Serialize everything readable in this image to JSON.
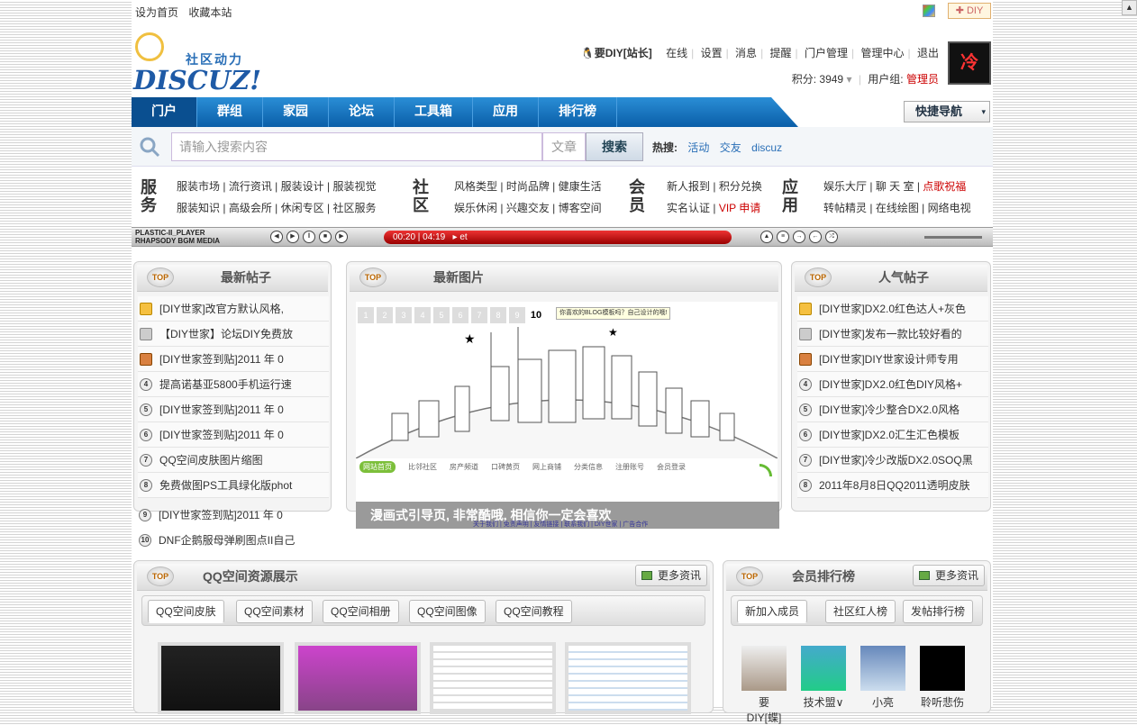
{
  "topbar": {
    "home": "设为首页",
    "fav": "收藏本站",
    "diy": "DIY"
  },
  "user": {
    "name": "要DIY[站长]",
    "links": [
      "在线",
      "设置",
      "消息",
      "提醒",
      "门户管理",
      "管理中心",
      "退出"
    ],
    "points": "积分: 3949",
    "group_label": "用户组:",
    "group": "管理员",
    "avatar_text": "冷"
  },
  "logo": {
    "cn": "社区动力",
    "en": "DISCUZ!"
  },
  "nav": {
    "items": [
      "门户",
      "群组",
      "家园",
      "论坛",
      "工具箱",
      "应用",
      "排行榜"
    ],
    "quick": "快捷导航"
  },
  "search": {
    "placeholder": "请输入搜索内容",
    "category": "文章",
    "button": "搜索",
    "hot_label": "热搜:",
    "hot": [
      "活动",
      "交友",
      "discuz"
    ]
  },
  "services": [
    {
      "head": "服务",
      "rows": [
        [
          "服装市场",
          "流行资讯",
          "服装设计",
          "服装视觉"
        ],
        [
          "服装知识",
          "高级会所",
          "休闲专区",
          "社区服务"
        ]
      ]
    },
    {
      "head": "社区",
      "rows": [
        [
          "风格类型",
          "时尚品牌",
          "健康生活"
        ],
        [
          "娱乐休闲",
          "兴趣交友",
          "博客空间"
        ]
      ]
    },
    {
      "head": "会员",
      "rows": [
        [
          "新人报到",
          "积分兑换"
        ],
        [
          "实名认证",
          "VIP 申请"
        ]
      ]
    },
    {
      "head": "应用",
      "rows": [
        [
          "娱乐大厅",
          "聊 天 室",
          "点歌祝福"
        ],
        [
          "转帖精灵",
          "在线绘图",
          "网络电视"
        ]
      ]
    }
  ],
  "player": {
    "name": "PLASTIC-II_PLAYER",
    "sub": "RHAPSODY BGM MEDIA",
    "time": "00:20 | 04:19",
    "track": "▸ et"
  },
  "latest": {
    "title": "最新帖子",
    "top": "TOP",
    "items": [
      "[DIY世家]改官方默认风格,",
      "【DIY世家】论坛DIY免费放",
      "[DIY世家签到贴]2011 年 0",
      "提高诺基亚5800手机运行速",
      "[DIY世家签到贴]2011 年 0",
      "[DIY世家签到贴]2011 年 0",
      "QQ空间皮肤图片缩图",
      "免费做图PS工具绿化版phot",
      "[DIY世家签到贴]2011 年 0",
      "DNF企鹅服母弹刷图点II自己"
    ]
  },
  "pics": {
    "title": "最新图片",
    "nums": [
      "1",
      "2",
      "3",
      "4",
      "5",
      "6",
      "7",
      "8",
      "9",
      "10"
    ],
    "bubble": "你喜欢的BLOG模板吗？自己设计的哦!",
    "tabs": [
      "网站首页",
      "比邻社区",
      "房产频道",
      "口碑黄页",
      "网上商铺",
      "分类信息",
      "注册账号",
      "会员登录"
    ],
    "caption": "漫画式引导页, 非常酷哦, 相信你一定会喜欢",
    "foot": "关于我们 | 免责声明 | 友情链接 | 联系我们 | DIY世家 | 广告合作"
  },
  "hot": {
    "title": "人气帖子",
    "items": [
      "[DIY世家]DX2.0红色达人+灰色",
      "[DIY世家]发布一款比较好看的",
      "[DIY世家]DIY世家设计师专用",
      "[DIY世家]DX2.0红色DIY风格+",
      "[DIY世家]冷少整合DX2.0风格",
      "[DIY世家]DX2.0汇生汇色模板",
      "[DIY世家]冷少改版DX2.0SOQ黑",
      "2011年8月8日QQ2011透明皮肤"
    ]
  },
  "qq": {
    "title": "QQ空间资源展示",
    "more": "更多资讯",
    "tabs": [
      "QQ空间皮肤",
      "QQ空间素材",
      "QQ空间相册",
      "QQ空间图像",
      "QQ空间教程"
    ]
  },
  "members": {
    "title": "会员排行榜",
    "more": "更多资讯",
    "tabs": [
      "新加入成员",
      "社区红人榜",
      "发帖排行榜"
    ],
    "names": [
      "要DIY[蝶]",
      "技术盟∨",
      "小亮",
      "聆听悲伤"
    ]
  },
  "colors": {
    "nav": "#0a5ea8",
    "accent_red": "#cc0000",
    "link": "#2a6fb7"
  }
}
